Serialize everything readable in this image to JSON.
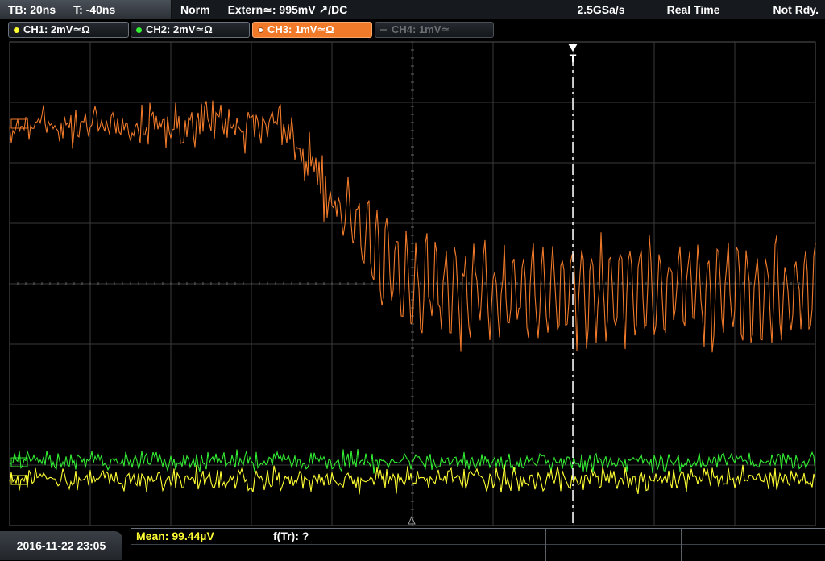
{
  "status": {
    "timebase": "TB: 20ns",
    "trigger_time": "T: -40ns",
    "mode": "Norm",
    "trigger": "Extern≃: 995mV ↗/DC",
    "sample_rate": "2.5GSa/s",
    "acquisition": "Real Time",
    "state": "Not Rdy."
  },
  "channels": [
    {
      "label": "CH1: 2mV≃Ω",
      "color": "#ffff33",
      "active": false,
      "enabled": true
    },
    {
      "label": "CH2: 2mV≃Ω",
      "color": "#33ee33",
      "active": false,
      "enabled": true
    },
    {
      "label": "CH3: 1mV≃Ω",
      "color": "#f07a2a",
      "active": true,
      "enabled": true
    },
    {
      "label": "CH4: 1mV≃",
      "color": "#6b6f74",
      "active": false,
      "enabled": false
    }
  ],
  "display": {
    "background": "#000000",
    "grid_color": "#3a3a3a",
    "trigger_marker": "T",
    "trigger_color": "#ffffff"
  },
  "footer": {
    "datetime": "2016-11-22 23:05",
    "measurements": [
      {
        "label": "Mean: 99.44µV",
        "color": "#ffff33"
      },
      {
        "label": "f(Tr): ?",
        "color": "#ffffff"
      }
    ]
  },
  "icons": [
    "trigger-arrow-icon",
    "channel-ground-marker-icon",
    "channel-dot-icon"
  ]
}
